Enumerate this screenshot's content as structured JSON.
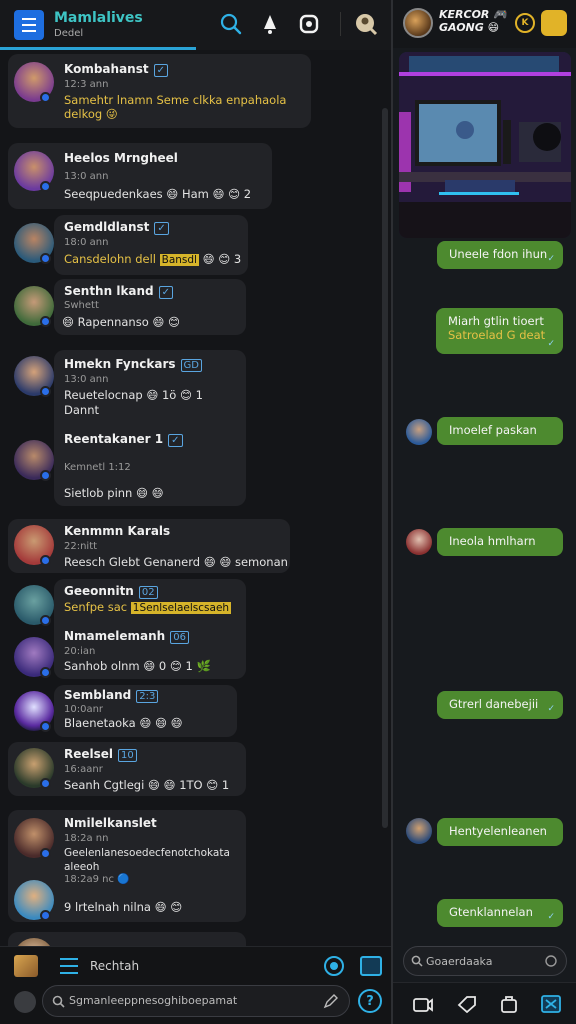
{
  "app": {
    "title": "Mamlalives",
    "subtitle": "Dedel"
  },
  "top_icons": [
    "search-icon",
    "bell-icon",
    "compose-icon",
    "profile-icon"
  ],
  "chats": [
    {
      "name": "Kombahanst",
      "tag": "✓",
      "time": "12:3 ann",
      "line2": "Samehtr lnamn Seme clkka enpahaola",
      "line3": "delkog 😜",
      "gold": true
    },
    {
      "name": "Heelos Mrngheel",
      "time": "13:0 ann",
      "line2": "Seeqpuedenkaes 😄 Ham 😄 😊 2",
      "gold": false
    },
    {
      "name": "Gemdldlanst",
      "tag": "✓",
      "time": "18:0 ann",
      "line2": "Cansdelohn dell",
      "highlight": "Bansdl",
      "line2_tail": "😄 😊 3",
      "gold": true
    },
    {
      "name": "Senthn lkand",
      "tag": "✓",
      "time": "Swhett",
      "line2": "😄 Rapennanso 😄 😊",
      "gold": false
    },
    {
      "name": "Hmekn Fynckars",
      "tag": "GD",
      "time": "13:0 ann",
      "line2": "Reuetelocnap 😄 1ö 😊 1",
      "line3": "Dannt",
      "gold": false
    },
    {
      "name": "Reentakaner 1",
      "tag": "✓",
      "time": "Kemnetl 1:12",
      "line2": "Sietlob pinn 😄 😄",
      "gold": false
    },
    {
      "name": "Kenmmn Karals",
      "time": "22:nitt",
      "line2": "Reesch Glebt Genanerd 😄 😄 semonan",
      "gold": false
    },
    {
      "name": "Geeonnitn",
      "tag": "02",
      "time": "",
      "line2": "Senfpe sac",
      "highlight": "1Senlselaelscsaeh",
      "gold": true
    },
    {
      "name": "Nmamelemanh",
      "tag": "06",
      "time": "20:ian",
      "line2": "Sanhob olnm 😄 0 😊 1 🌿",
      "gold": false
    },
    {
      "name": "Sembland",
      "tag": "2:3",
      "time": "10:0anr",
      "line2": "Blaenetaoka 😄 😄 😄",
      "gold": false
    },
    {
      "name": "Reelsel",
      "tag": "10",
      "time": "16:aanr",
      "line2": "Seanh Cgtlegi 😄 😄 1TO 😊 1",
      "gold": false
    },
    {
      "name": "Nmilelkanslet",
      "time": "18:2a nn",
      "line2": "Geelenlanesoedecfenotchokata",
      "line3": "aleeoh",
      "gold": false
    },
    {
      "name": "",
      "time": "18:2a9 nc 🔵",
      "line2": "9 lrtelnah nilna 😄 😊",
      "gold": false
    }
  ],
  "composer": {
    "label": "Rechtah",
    "placeholder": "Sgmanleeppnesoghiboepamat"
  },
  "right": {
    "title_line1": "KERCOR 🎮",
    "title_line2": "GAONG 😄",
    "messages": [
      {
        "text": "Uneele fdon ihun",
        "side": "out"
      },
      {
        "text": "Miarh gtlin tioert",
        "sub": "Satroelad G deat",
        "side": "out"
      },
      {
        "text": "Imoelef paskan",
        "side": "in"
      },
      {
        "text": "Ineola hmlharn",
        "side": "in"
      },
      {
        "text": "Gtrerl danebejii",
        "side": "out"
      },
      {
        "text": "Hentyelenleanen",
        "side": "in"
      },
      {
        "text": "Gtenklannelan",
        "side": "out"
      }
    ],
    "search_placeholder": "Goaerdaaka"
  },
  "colors": {
    "accent": "#2aa3d6",
    "bubble_green": "#4d8a2f",
    "gold": "#e5c146",
    "card_bg": "#222327"
  }
}
